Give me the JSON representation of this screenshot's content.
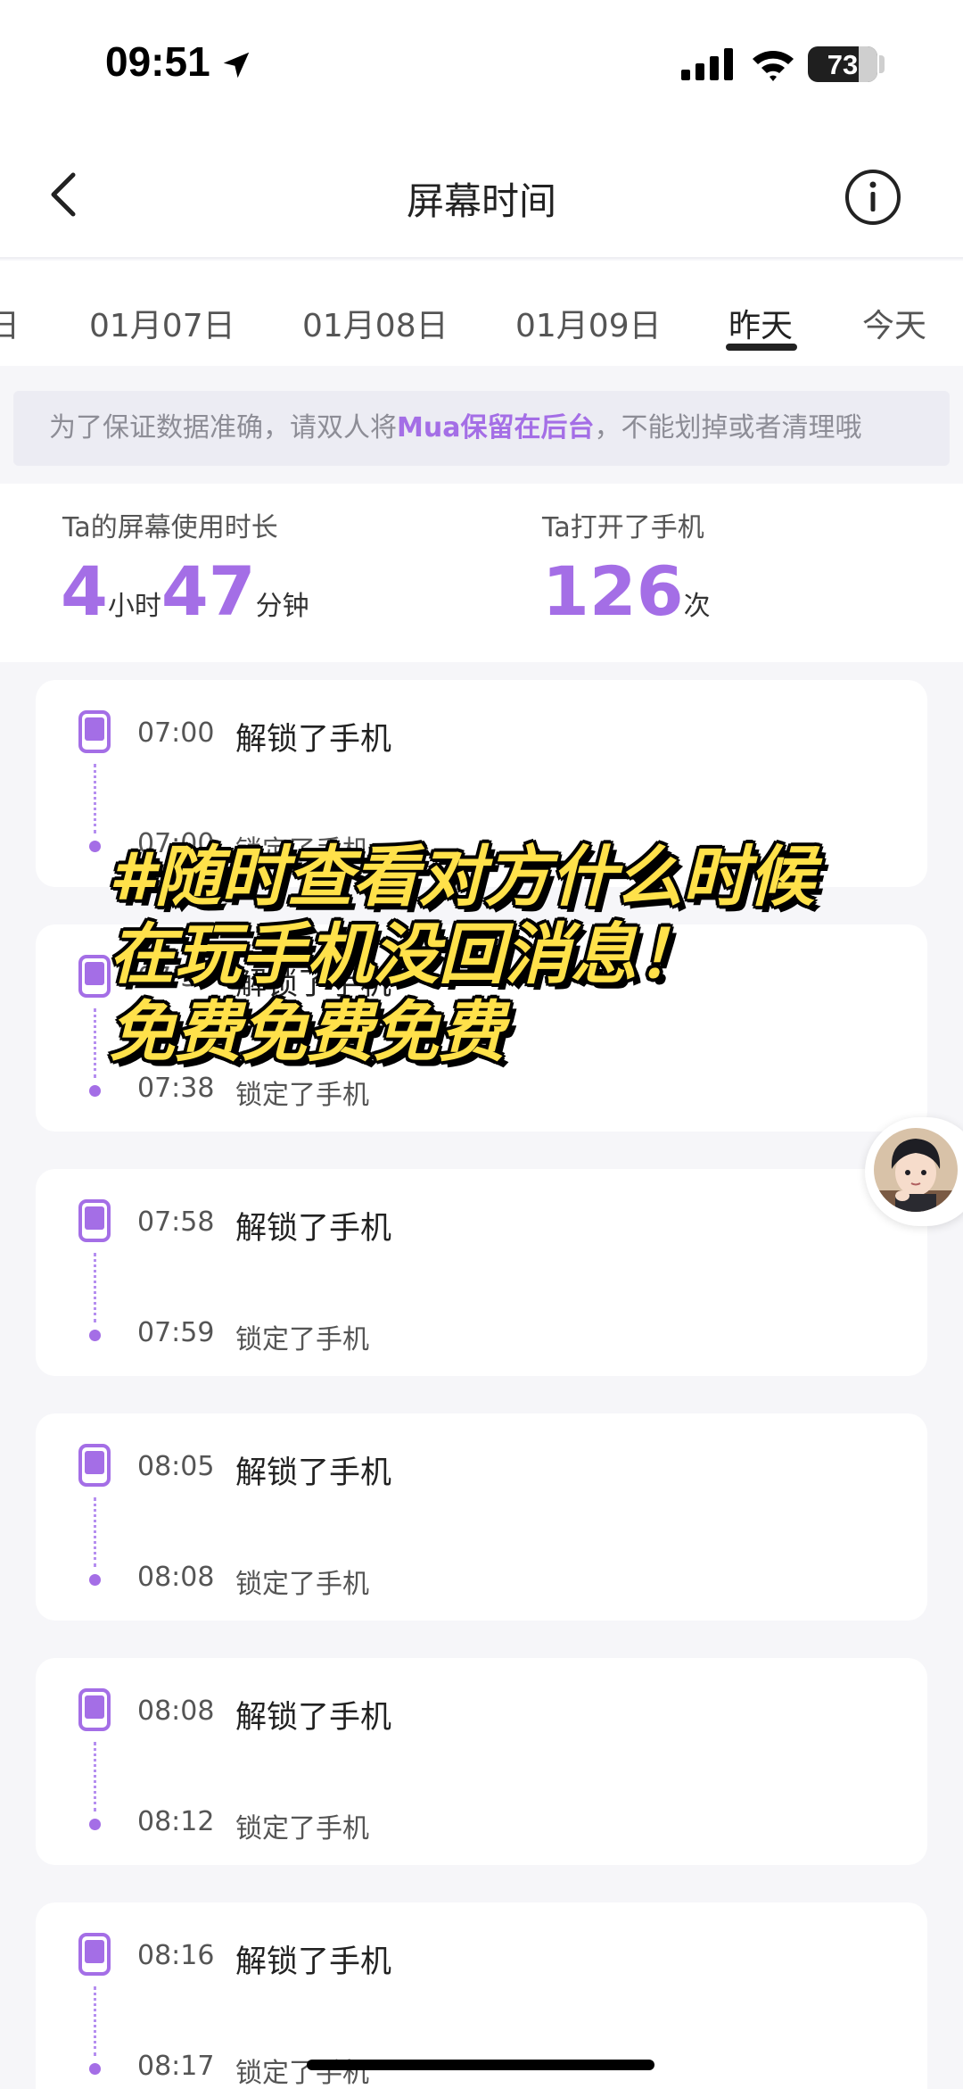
{
  "status": {
    "time": "09:51",
    "battery": "73",
    "battery_level": 0.73
  },
  "nav": {
    "title": "屏幕时间"
  },
  "tabs": [
    {
      "label": "日"
    },
    {
      "label": "01月07日"
    },
    {
      "label": "01月08日"
    },
    {
      "label": "01月09日"
    },
    {
      "label": "昨天",
      "active": true
    },
    {
      "label": "今天"
    }
  ],
  "notice": {
    "pre": "为了保证数据准确，请双人将",
    "highlight": "Mua保留在后台",
    "post": "，不能划掉或者清理哦"
  },
  "stats": {
    "usage_label": "Ta的屏幕使用时长",
    "hours": "4",
    "hours_unit": "小时",
    "minutes": "47",
    "minutes_unit": "分钟",
    "opens_label": "Ta打开了手机",
    "opens": "126",
    "opens_unit": "次"
  },
  "events": [
    {
      "unlock_time": "07:00",
      "unlock_label": "解锁了手机",
      "lock_time": "07:00",
      "lock_label": "锁定了手机"
    },
    {
      "unlock_time": "07:37",
      "unlock_label": "解锁了手机",
      "lock_time": "07:38",
      "lock_label": "锁定了手机"
    },
    {
      "unlock_time": "07:58",
      "unlock_label": "解锁了手机",
      "lock_time": "07:59",
      "lock_label": "锁定了手机"
    },
    {
      "unlock_time": "08:05",
      "unlock_label": "解锁了手机",
      "lock_time": "08:08",
      "lock_label": "锁定了手机"
    },
    {
      "unlock_time": "08:08",
      "unlock_label": "解锁了手机",
      "lock_time": "08:12",
      "lock_label": "锁定了手机"
    },
    {
      "unlock_time": "08:16",
      "unlock_label": "解锁了手机",
      "lock_time": "08:17",
      "lock_label": "锁定了手机"
    }
  ],
  "overlay": {
    "line1": "#随时查看对方什么时候",
    "line2": "在玩手机没回消息！",
    "line3": "免费免费免费"
  },
  "colors": {
    "accent": "#a46ee6",
    "overlay_text": "#ffe14a"
  },
  "icons": {
    "location": "location-arrow-icon",
    "signal": "signal-icon",
    "wifi": "wifi-icon",
    "back": "chevron-left-icon",
    "info": "info-icon",
    "phone": "phone-icon"
  }
}
